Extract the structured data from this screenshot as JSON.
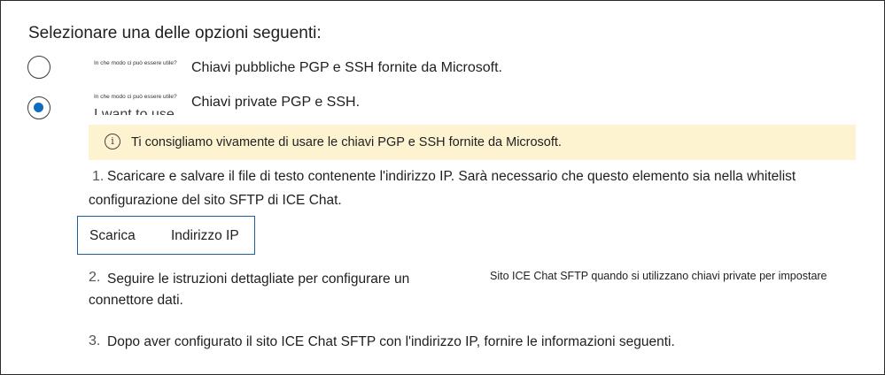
{
  "heading": "Selezionare una delle opzioni seguenti:",
  "options": [
    {
      "hint": "In che modo ci può essere utile?",
      "label": "Chiavi pubbliche PGP e SSH fornite da Microsoft.",
      "selected": false
    },
    {
      "hint": "In che modo ci può essere utile?",
      "label": "Chiavi private PGP e SSH.",
      "selected": true
    }
  ],
  "ghost_text": "I want to use",
  "banner": {
    "icon": "info-icon",
    "text": "Ti consigliamo vivamente di usare le chiavi PGP e SSH fornite da Microsoft.",
    "background": "#fdf3d1"
  },
  "steps": [
    {
      "number": "1.",
      "line1": "Scaricare e salvare il file di testo contenente l'indirizzo IP. Sarà necessario che questo elemento sia nella whitelist",
      "line2": "configurazione del sito SFTP di ICE Chat."
    },
    {
      "number": "2.",
      "line1": "Seguire le istruzioni dettagliate per configurare un",
      "line2": "connettore dati.",
      "side_text": "Sito ICE Chat SFTP quando si utilizzano chiavi private per impostare"
    },
    {
      "number": "3.",
      "line1": "Dopo aver configurato il sito ICE Chat SFTP con l'indirizzo IP, fornire le informazioni seguenti."
    }
  ],
  "download_button": {
    "part1": "Scarica",
    "part2": "Indirizzo IP",
    "border_color": "#1f5f99"
  },
  "accent_color": "#0f6cbd"
}
